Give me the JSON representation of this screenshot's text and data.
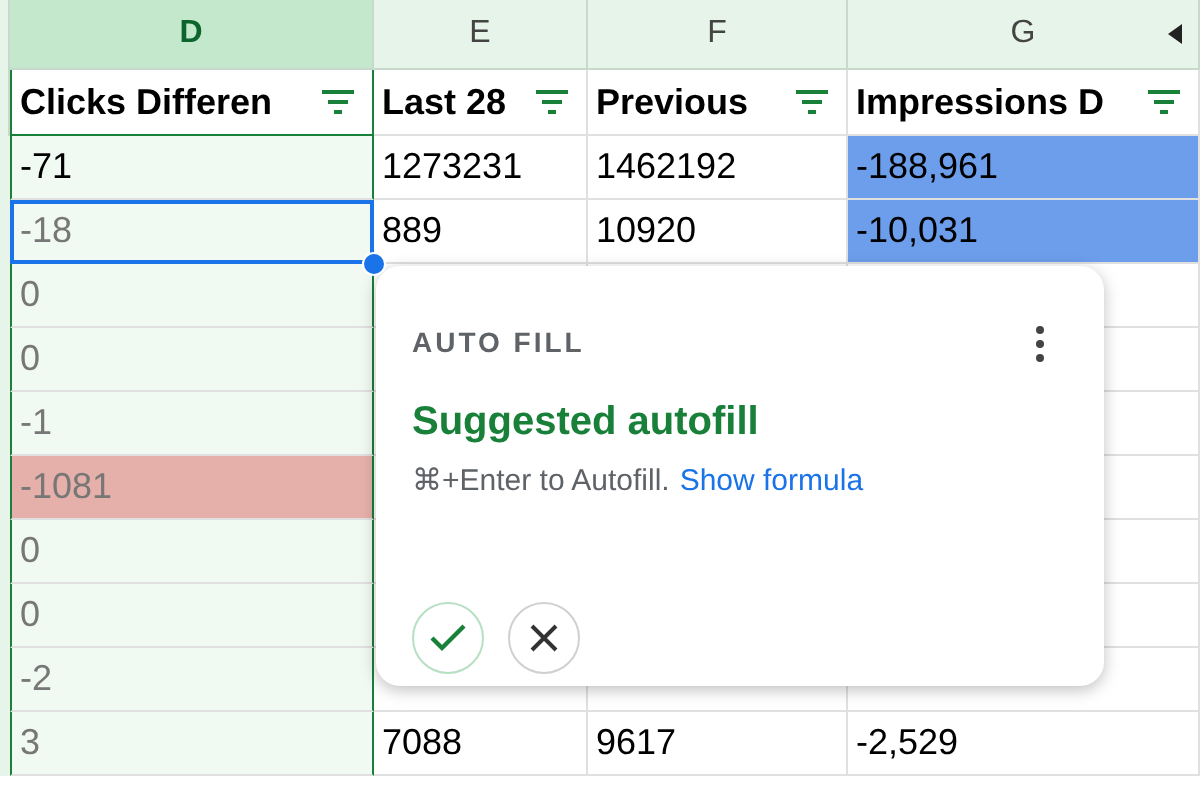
{
  "columns": [
    {
      "letter": "D",
      "header": "Clicks Differen",
      "selected": true
    },
    {
      "letter": "E",
      "header": "Last 28",
      "selected": false
    },
    {
      "letter": "F",
      "header": "Previous",
      "selected": false
    },
    {
      "letter": "G",
      "header": "Impressions D",
      "selected": false
    }
  ],
  "rows": [
    [
      {
        "text": "-71",
        "suggested": false
      },
      {
        "text": "1273231"
      },
      {
        "text": "1462192"
      },
      {
        "text": "-188,961",
        "color": "#6d9eeb"
      }
    ],
    [
      {
        "text": "-18",
        "suggested": true,
        "selected": true
      },
      {
        "text": "889"
      },
      {
        "text": "10920"
      },
      {
        "text": "-10,031",
        "color": "#6d9eeb"
      }
    ],
    [
      {
        "text": "0",
        "suggested": true
      }
    ],
    [
      {
        "text": "0",
        "suggested": true
      }
    ],
    [
      {
        "text": "-1",
        "suggested": true
      }
    ],
    [
      {
        "text": "-1081",
        "suggested": true,
        "color": "#e6b0aa"
      }
    ],
    [
      {
        "text": "0",
        "suggested": true
      }
    ],
    [
      {
        "text": "0",
        "suggested": true
      }
    ],
    [
      {
        "text": "-2",
        "suggested": true
      }
    ],
    [
      {
        "text": "3",
        "suggested": true
      },
      {
        "text": "7088"
      },
      {
        "text": "9617"
      },
      {
        "text": "-2,529"
      }
    ]
  ],
  "popup": {
    "label": "AUTO FILL",
    "title": "Suggested autofill",
    "hint": "⌘+Enter to Autofill.",
    "link": "Show formula"
  }
}
